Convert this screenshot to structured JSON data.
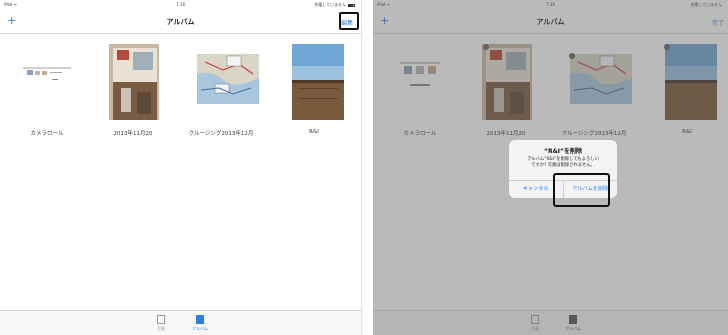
{
  "left": {
    "status": {
      "left": "iPad ᯤ",
      "time": "7:16",
      "right": "充電していません"
    },
    "nav": {
      "title": "アルバム",
      "add": "+",
      "edit": "編集"
    },
    "albums": [
      {
        "label": "カメラロール"
      },
      {
        "label": "2013年11月20"
      },
      {
        "label": "クルージング2013年12月"
      },
      {
        "label": "R&I"
      }
    ],
    "tabs": [
      {
        "label": "写真"
      },
      {
        "label": "アルバム"
      }
    ]
  },
  "right": {
    "status": {
      "left": "iPad ᯤ",
      "time": "7:16",
      "right": "充電していません"
    },
    "nav": {
      "title": "アルバム",
      "add": "+",
      "done": "完了"
    },
    "albums": [
      {
        "label": "カメラロール"
      },
      {
        "label": "2013年11月20"
      },
      {
        "label": "クルージング2013年12月"
      },
      {
        "label": "R&I"
      }
    ],
    "tabs": [
      {
        "label": "写真"
      },
      {
        "label": "アルバム"
      }
    ],
    "dialog": {
      "title": "“R&I”を削除",
      "line1": "アルバム“R&I”を削除してもよろしい",
      "line2": "ですか? 写真は削除されません。",
      "cancel": "キャンセル",
      "confirm": "アルバムを削除"
    }
  },
  "colors": {
    "accent": "#2f7fe0",
    "dim_overlay": "rgba(90,90,90,0.42)"
  },
  "icons": [
    "add-icon",
    "photos-tab-icon",
    "albums-tab-icon",
    "battery-icon",
    "wifi-icon",
    "delete-badge-icon"
  ]
}
